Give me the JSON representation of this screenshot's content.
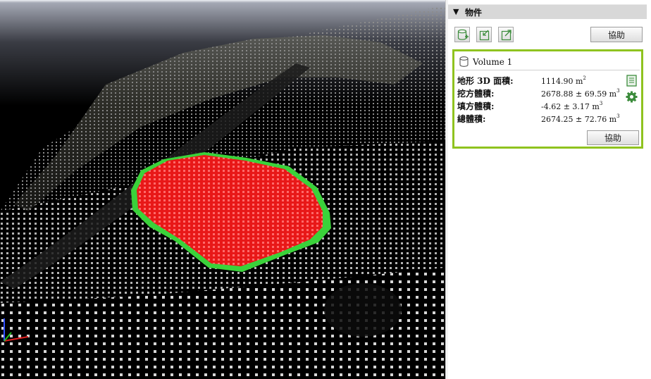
{
  "panel": {
    "title": "物件",
    "help_label": "協助"
  },
  "volume": {
    "name": "Volume 1",
    "help_label": "協助",
    "rows": [
      {
        "label": "地形 3D 面積:",
        "value": "1114.90 m",
        "sup": "2"
      },
      {
        "label": "挖方體積:",
        "value": "2678.88 ± 69.59 m",
        "sup": "3"
      },
      {
        "label": "填方體積:",
        "value": "-4.62 ± 3.17 m",
        "sup": "3"
      },
      {
        "label": "總體積:",
        "value": "2674.25 ± 72.76 m",
        "sup": "3"
      }
    ]
  },
  "icons": {
    "toolbar": [
      "add-volume-icon",
      "import-icon",
      "export-icon"
    ],
    "side": [
      "report-icon",
      "gear-icon"
    ],
    "volume": "database-icon",
    "axes": "axis-gizmo-icon"
  },
  "colors": {
    "accent_border": "#8fc31f",
    "cut_fill": "#ff2020",
    "fill_region": "#3ad23a",
    "icon_green": "#3c8c3c"
  }
}
